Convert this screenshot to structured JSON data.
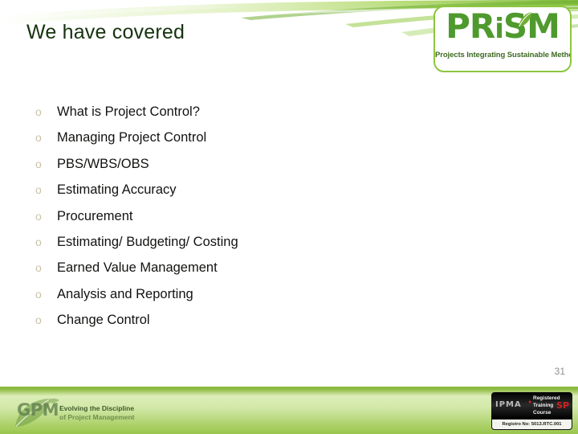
{
  "slide": {
    "title": "We have covered",
    "page_number": "31",
    "accent_color": "#8cc63f",
    "title_color": "#16330f",
    "body_text_color": "#121210",
    "bullet_marker_color": "#c8c3a8",
    "footer_band_color": "#d2e8a7"
  },
  "bullets": [
    {
      "marker": "o",
      "text": "What is Project Control?"
    },
    {
      "marker": "o",
      "text": "Managing Project Control"
    },
    {
      "marker": "o",
      "text": "PBS/WBS/OBS"
    },
    {
      "marker": "o",
      "text": "Estimating Accuracy"
    },
    {
      "marker": "o",
      "text": "Procurement"
    },
    {
      "marker": "o",
      "text": "Estimating/ Budgeting/ Costing"
    },
    {
      "marker": "o",
      "text": "Earned Value Management"
    },
    {
      "marker": "o",
      "text": "Analysis and Reporting"
    },
    {
      "marker": "o",
      "text": "Change Control"
    }
  ],
  "prism_logo": {
    "word_pr": "PR",
    "word_i": "i",
    "word_sm": "SM",
    "tagline": "Projects Integrating Sustainable Methods",
    "leaf_icon": "leaf-icon",
    "brand_green": "#4f9a2e",
    "border_green": "#8cc63f"
  },
  "gpm_logo": {
    "word": "GPM",
    "tagline_line1": "Evolving the Discipline",
    "tagline_line2": "of Project Management",
    "leaf_icon": "leaf-icon"
  },
  "ipma_badge": {
    "brand": "IPMA",
    "line1": "Registered",
    "line2": "Training",
    "line3": "Course",
    "level": "SP",
    "registration": "Registro No: 5013.RTC.001"
  }
}
